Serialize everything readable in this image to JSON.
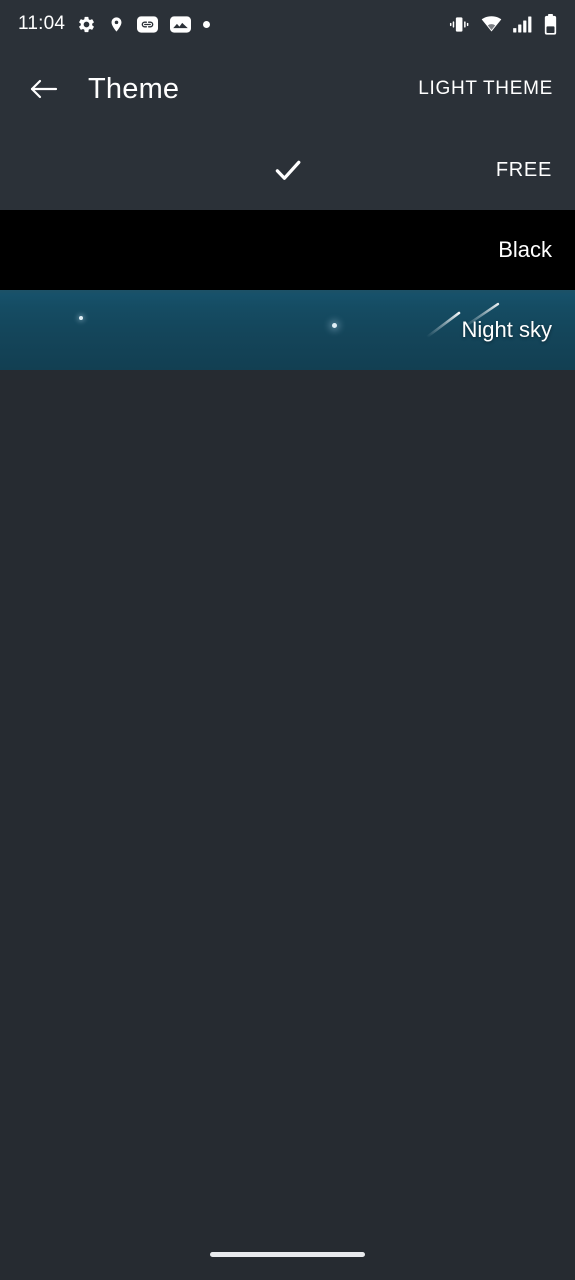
{
  "status_bar": {
    "clock": "11:04",
    "left_icons": [
      "gear-icon",
      "location-pin-icon",
      "link-icon",
      "image-icon",
      "dot-icon"
    ],
    "right_icons": [
      "vibrate-icon",
      "wifi-icon",
      "cellular-signal-icon",
      "battery-icon"
    ]
  },
  "app_bar": {
    "back_icon": "back-arrow-icon",
    "title": "Theme",
    "action_label": "LIGHT THEME"
  },
  "theme_list": {
    "items": [
      {
        "label": "FREE",
        "selected": true,
        "style": "free",
        "check_icon": "checkmark-icon"
      },
      {
        "label": "Black",
        "selected": false,
        "style": "black",
        "check_icon": "checkmark-icon"
      },
      {
        "label": "Night sky",
        "selected": false,
        "style": "night",
        "check_icon": "checkmark-icon"
      }
    ]
  },
  "colors": {
    "status_bar_bg": "#2b3138",
    "app_bar_bg": "#2b3138",
    "page_bg": "#262b31",
    "row_free_bg": "#2b3138",
    "row_black_bg": "#000000",
    "row_night_top": "#1d5166",
    "row_night_bottom": "#123f52",
    "text_primary": "#ffffff",
    "nav_pill": "#e8eaed"
  },
  "nav_bar": {
    "pill": "gesture-home-pill"
  }
}
